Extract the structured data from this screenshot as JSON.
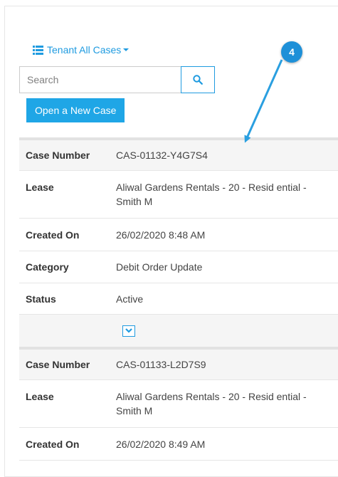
{
  "view_selector": {
    "label": "Tenant All Cases"
  },
  "search": {
    "placeholder": "Search",
    "value": ""
  },
  "new_case_button": {
    "label": "Open a New Case"
  },
  "callout": {
    "number": "4"
  },
  "cases": [
    {
      "rows": [
        {
          "label": "Case Number",
          "value": "CAS-01132-Y4G7S4"
        },
        {
          "label": "Lease",
          "value": "Aliwal Gardens Rentals - 20 - Resid ential - Smith M"
        },
        {
          "label": "Created On",
          "value": "26/02/2020 8:48 AM"
        },
        {
          "label": "Category",
          "value": "Debit Order Update"
        },
        {
          "label": "Status",
          "value": "Active"
        }
      ]
    },
    {
      "rows": [
        {
          "label": "Case Number",
          "value": "CAS-01133-L2D7S9"
        },
        {
          "label": "Lease",
          "value": "Aliwal Gardens Rentals - 20 - Resid ential - Smith M"
        },
        {
          "label": "Created On",
          "value": "26/02/2020 8:49 AM"
        }
      ]
    }
  ],
  "colors": {
    "accent": "#1f9be0",
    "button_bg": "#1fa6e6",
    "badge": "#1e90d8"
  },
  "icons": {
    "view": "list-icon",
    "search": "search-icon",
    "expand": "chevron-down-icon"
  }
}
